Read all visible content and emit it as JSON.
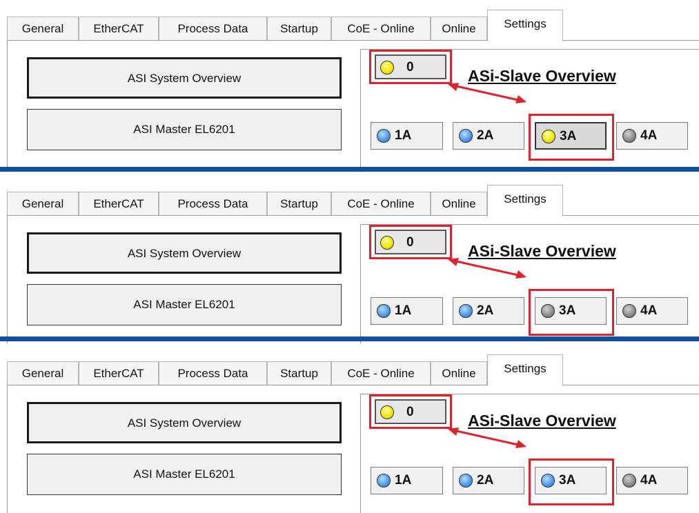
{
  "tabs": [
    "General",
    "EtherCAT",
    "Process Data",
    "Startup",
    "CoE - Online",
    "Online",
    "Settings"
  ],
  "active_tab": "Settings",
  "buttons": {
    "system_overview": "ASI System Overview",
    "master": "ASI Master EL6201"
  },
  "group_title": "ASi-Slave Overview",
  "colors": {
    "highlight": "#e0202a",
    "divider": "#0f4fa0",
    "led_yellow": "#f5e900",
    "led_blue": "#4f9cf0",
    "led_gray": "#8f8f8f"
  },
  "panels": [
    {
      "zero": {
        "label": "0",
        "led": "yellow"
      },
      "slaves": [
        {
          "label": "1A",
          "led": "blue"
        },
        {
          "label": "2A",
          "led": "blue"
        },
        {
          "label": "3A",
          "led": "yellow",
          "pressed": true
        },
        {
          "label": "4A",
          "led": "gray"
        }
      ]
    },
    {
      "zero": {
        "label": "0",
        "led": "yellow"
      },
      "slaves": [
        {
          "label": "1A",
          "led": "blue"
        },
        {
          "label": "2A",
          "led": "blue"
        },
        {
          "label": "3A",
          "led": "gray",
          "pressed": false
        },
        {
          "label": "4A",
          "led": "gray"
        }
      ]
    },
    {
      "zero": {
        "label": "0",
        "led": "yellow"
      },
      "slaves": [
        {
          "label": "1A",
          "led": "blue"
        },
        {
          "label": "2A",
          "led": "blue"
        },
        {
          "label": "3A",
          "led": "blue",
          "pressed": false
        },
        {
          "label": "4A",
          "led": "gray"
        }
      ]
    }
  ]
}
